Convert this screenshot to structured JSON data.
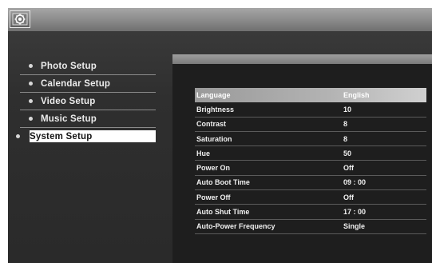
{
  "header": {
    "icon": "settings-icon"
  },
  "menu": {
    "items": [
      {
        "label": "Photo Setup",
        "selected": false
      },
      {
        "label": "Calendar Setup",
        "selected": false
      },
      {
        "label": "Video Setup",
        "selected": false
      },
      {
        "label": "Music Setup",
        "selected": false
      },
      {
        "label": "System Setup",
        "selected": true
      }
    ]
  },
  "settings": {
    "rows": [
      {
        "name": "Language",
        "value": "English",
        "highlighted": true
      },
      {
        "name": "Brightness",
        "value": "10"
      },
      {
        "name": "Contrast",
        "value": "8"
      },
      {
        "name": "Saturation",
        "value": "8"
      },
      {
        "name": "Hue",
        "value": "50"
      },
      {
        "name": "Power On",
        "value": "Off"
      },
      {
        "name": "Auto Boot Time",
        "value": "09 : 00"
      },
      {
        "name": "Power Off",
        "value": "Off"
      },
      {
        "name": "Auto Shut Time",
        "value": "17 : 00"
      },
      {
        "name": "Auto-Power Frequency",
        "value": "Single"
      }
    ]
  },
  "colors": {
    "background": "#2f2f2f",
    "panel": "#1e1e1e",
    "highlight": "#b3b3b3",
    "text": "#f0f0f0"
  }
}
